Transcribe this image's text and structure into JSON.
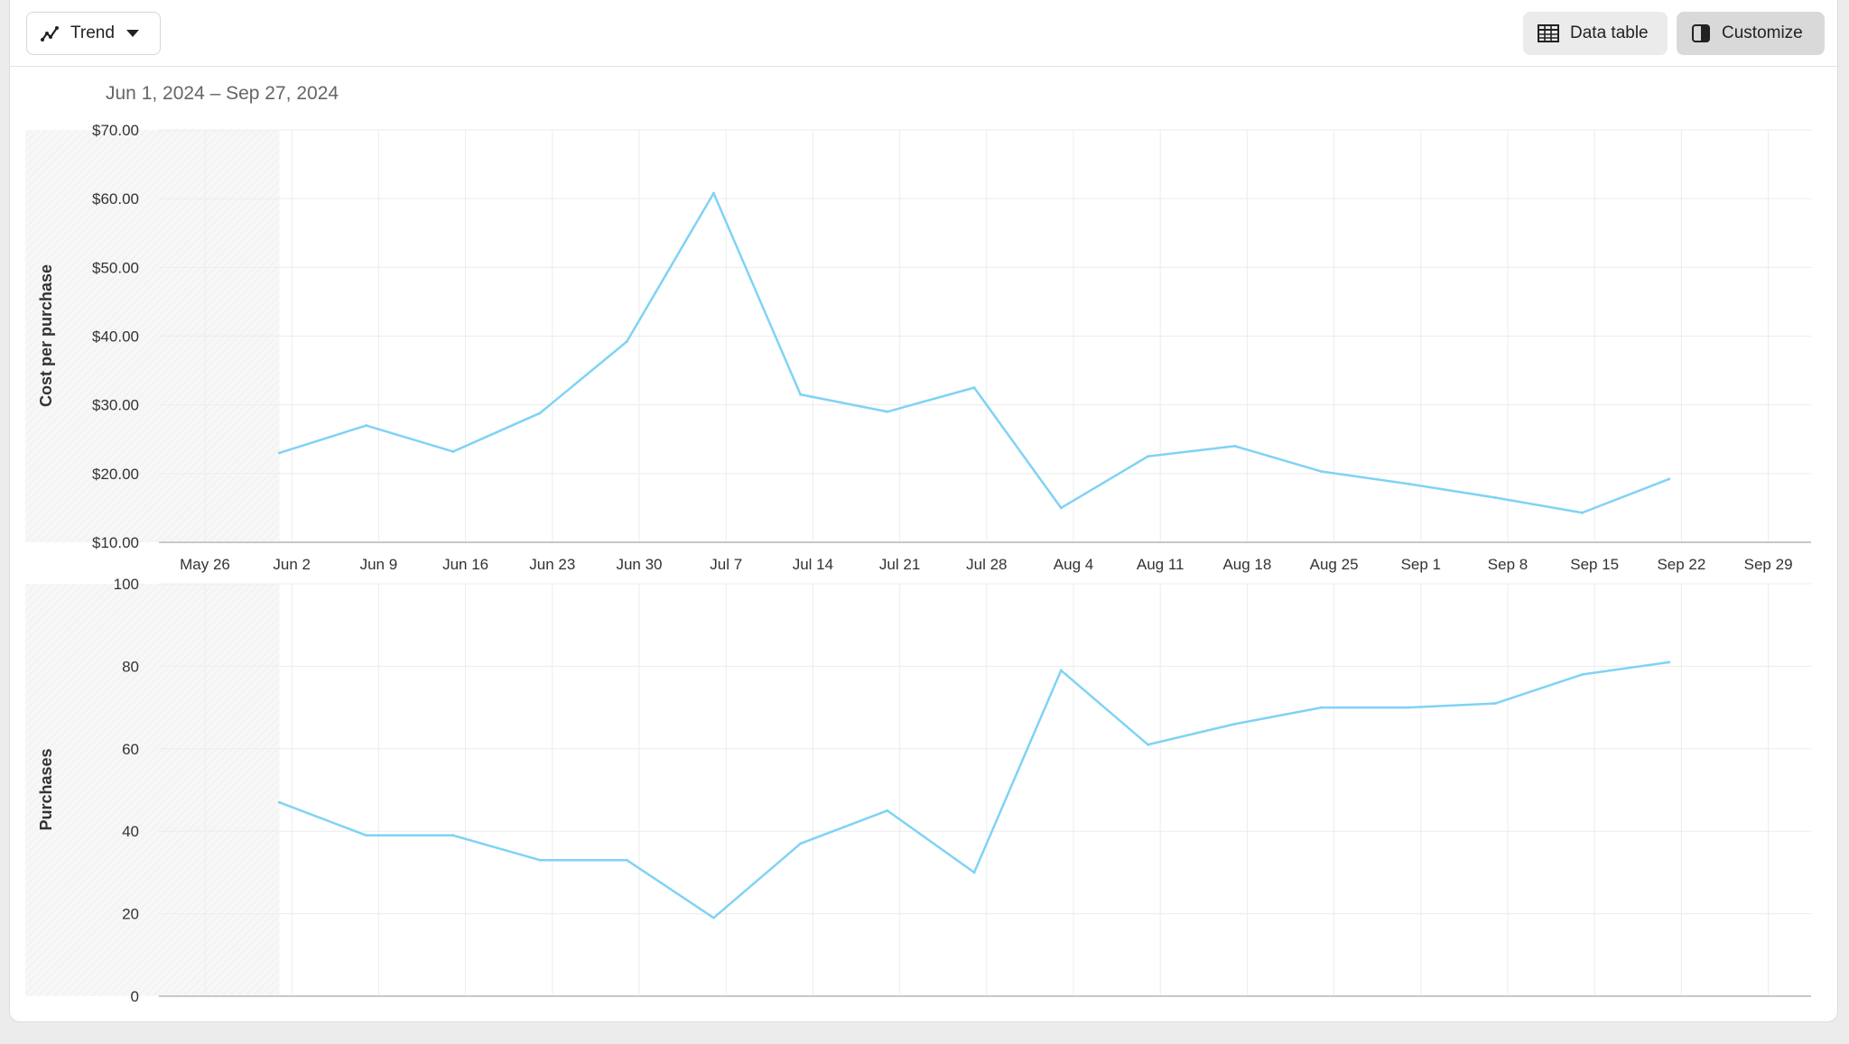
{
  "toolbar": {
    "trend_label": "Trend",
    "data_table_label": "Data table",
    "customize_label": "Customize"
  },
  "date_range": "Jun 1, 2024 – Sep 27, 2024",
  "colors": {
    "line": "#7fd3f5",
    "grid": "#ececec",
    "axis": "#c8c8c8",
    "hatch_band": "#f7f7f7"
  },
  "chart_data": [
    {
      "type": "line",
      "ylabel": "Cost per purchase",
      "ylim": [
        10,
        70
      ],
      "y_ticks": [
        "$10.00",
        "$20.00",
        "$30.00",
        "$40.00",
        "$50.00",
        "$60.00",
        "$70.00"
      ],
      "x_ticks": [
        "May 26",
        "Jun 2",
        "Jun 9",
        "Jun 16",
        "Jun 23",
        "Jun 30",
        "Jul 7",
        "Jul 14",
        "Jul 21",
        "Jul 28",
        "Aug 4",
        "Aug 11",
        "Aug 18",
        "Aug 25",
        "Sep 1",
        "Sep 8",
        "Sep 15",
        "Sep 22",
        "Sep 29"
      ],
      "grid": true,
      "series": [
        {
          "x": [
            "Jun 1",
            "Jun 8",
            "Jun 15",
            "Jun 22",
            "Jun 29",
            "Jul 6",
            "Jul 13",
            "Jul 20",
            "Jul 27",
            "Aug 3",
            "Aug 10",
            "Aug 17",
            "Aug 24",
            "Aug 31",
            "Sep 7",
            "Sep 14",
            "Sep 21"
          ],
          "values": [
            23.0,
            27.0,
            23.2,
            28.8,
            39.2,
            60.8,
            31.5,
            29.0,
            32.5,
            15.0,
            22.5,
            24.0,
            20.3,
            18.5,
            16.5,
            14.3,
            19.2
          ]
        }
      ]
    },
    {
      "type": "line",
      "ylabel": "Purchases",
      "ylim": [
        0,
        100
      ],
      "y_ticks": [
        "0",
        "20",
        "40",
        "60",
        "80",
        "100"
      ],
      "grid": true,
      "series": [
        {
          "x": [
            "Jun 1",
            "Jun 8",
            "Jun 15",
            "Jun 22",
            "Jun 29",
            "Jul 6",
            "Jul 13",
            "Jul 20",
            "Jul 27",
            "Aug 3",
            "Aug 10",
            "Aug 17",
            "Aug 24",
            "Aug 31",
            "Sep 7",
            "Sep 14",
            "Sep 21"
          ],
          "values": [
            47,
            39,
            39,
            33,
            33,
            19,
            37,
            45,
            30,
            79,
            61,
            66,
            70,
            70,
            71,
            78,
            81
          ]
        }
      ]
    }
  ]
}
